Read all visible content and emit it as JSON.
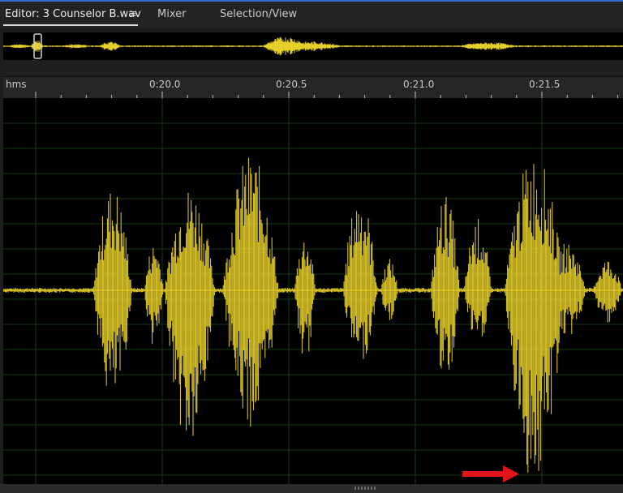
{
  "tabs": [
    {
      "label": "Editor: 3 Counselor B.wav",
      "active": true
    },
    {
      "label": "Mixer",
      "active": false
    },
    {
      "label": "Selection/View",
      "active": false
    }
  ],
  "panel_menu_icon": "hamburger-menu-icon",
  "ruler": {
    "unit_label": "hms",
    "ticks": [
      "0:20.0",
      "0:20.5",
      "0:21.0",
      "0:21.5"
    ]
  },
  "annotation": {
    "icon": "red-arrow-icon",
    "color": "#e0141a"
  },
  "colors": {
    "waveform": "#e6cf2a",
    "background": "#000000",
    "grid": "#1a3d1a",
    "active_tab_underline": "#d8d8d8",
    "top_border": "#2f6fcf"
  }
}
